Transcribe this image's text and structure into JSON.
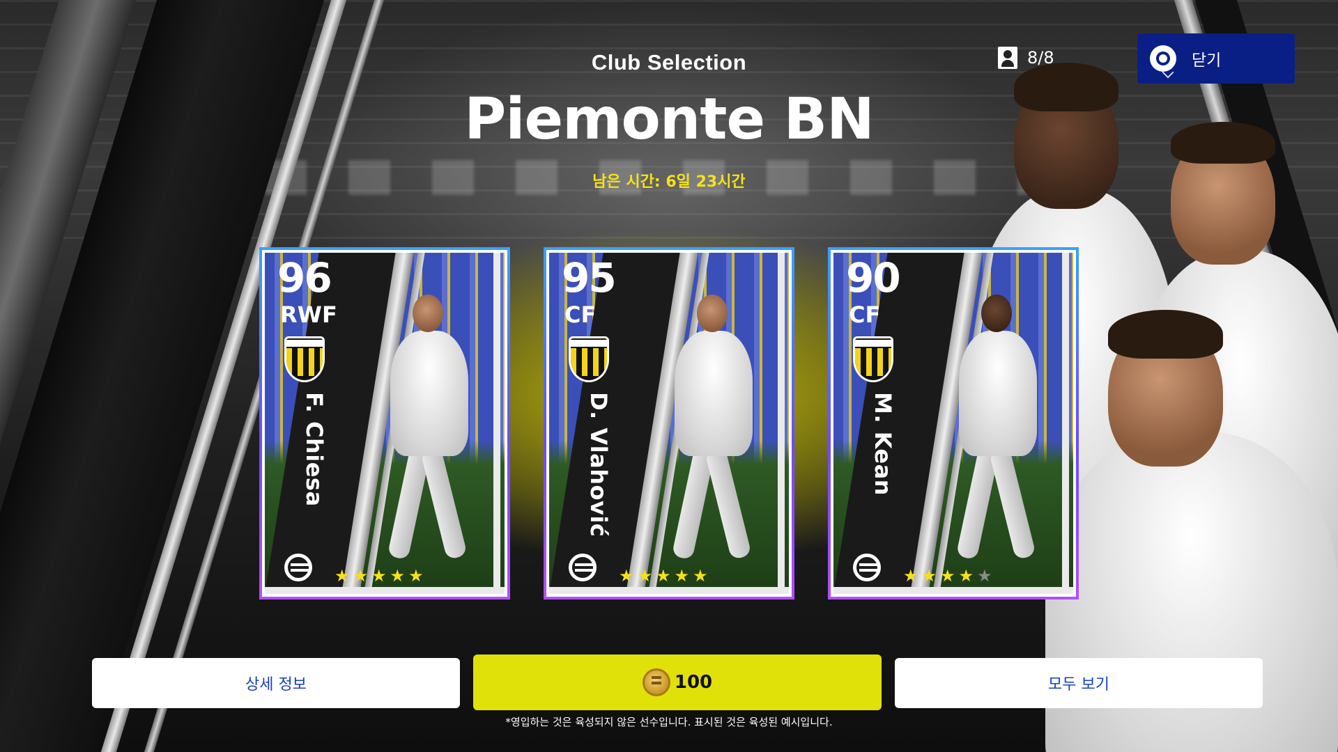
{
  "header": {
    "subtitle": "Club Selection",
    "title": "Piemonte BN",
    "remaining_time": "남은 시간: 6일 23시간"
  },
  "squad": {
    "icon": "person-icon",
    "count": "8/8"
  },
  "close_button": {
    "icon": "circle-button-icon",
    "label": "닫기",
    "color": "#0a1f85"
  },
  "cards": [
    {
      "rating": "96",
      "position": "RWF",
      "name": "F. Chiesa",
      "stars_filled": 5,
      "stars_total": 5,
      "skin": "light"
    },
    {
      "rating": "95",
      "position": "CF",
      "name": "D. Vlahović",
      "stars_filled": 5,
      "stars_total": 5,
      "skin": "light"
    },
    {
      "rating": "90",
      "position": "CF",
      "name": "M. Kean",
      "stars_filled": 4,
      "stars_total": 5,
      "skin": "dark"
    }
  ],
  "buttons": {
    "detail": "상세 정보",
    "buy_amount": "100",
    "buy_icon": "efootball-coin-icon",
    "view_all": "모두 보기"
  },
  "note": "*영입하는 것은 육성되지 않은 선수입니다. 표시된 것은 육성된 예시입니다.",
  "colors": {
    "accent_yellow": "#e1e10a",
    "link_blue": "#1540c8",
    "star_yellow": "#f5e11a"
  }
}
